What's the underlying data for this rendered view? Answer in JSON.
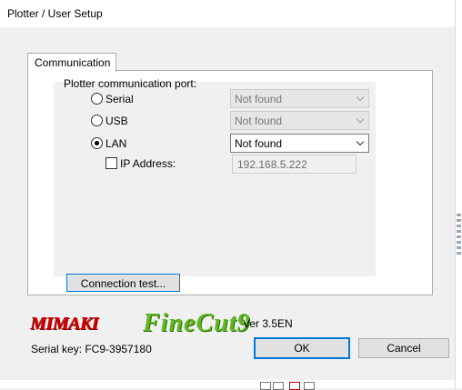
{
  "window": {
    "title": "Plotter / User Setup"
  },
  "tabs": [
    {
      "label": "Communication",
      "active": true
    }
  ],
  "communication": {
    "port_label": "Plotter communication port:",
    "options": [
      {
        "label": "Serial",
        "selected": false,
        "value": "Not found",
        "enabled": false
      },
      {
        "label": "USB",
        "selected": false,
        "value": "Not found",
        "enabled": false
      },
      {
        "label": "LAN",
        "selected": true,
        "value": "Not found",
        "enabled": true
      }
    ],
    "ip": {
      "label": "IP Address:",
      "checked": false,
      "value": "192.168.5.222",
      "enabled": false
    },
    "connection_test_label": "Connection test..."
  },
  "footer": {
    "brand": "MIMAKI",
    "product": "FineCut9",
    "version": "Ver 3.5EN",
    "serial_key": "Serial key: FC9-3957180",
    "ok_label": "OK",
    "cancel_label": "Cancel"
  },
  "colors": {
    "brand_red": "#d40000",
    "product_green": "#5fb81f",
    "focus_blue": "#0078d7"
  }
}
